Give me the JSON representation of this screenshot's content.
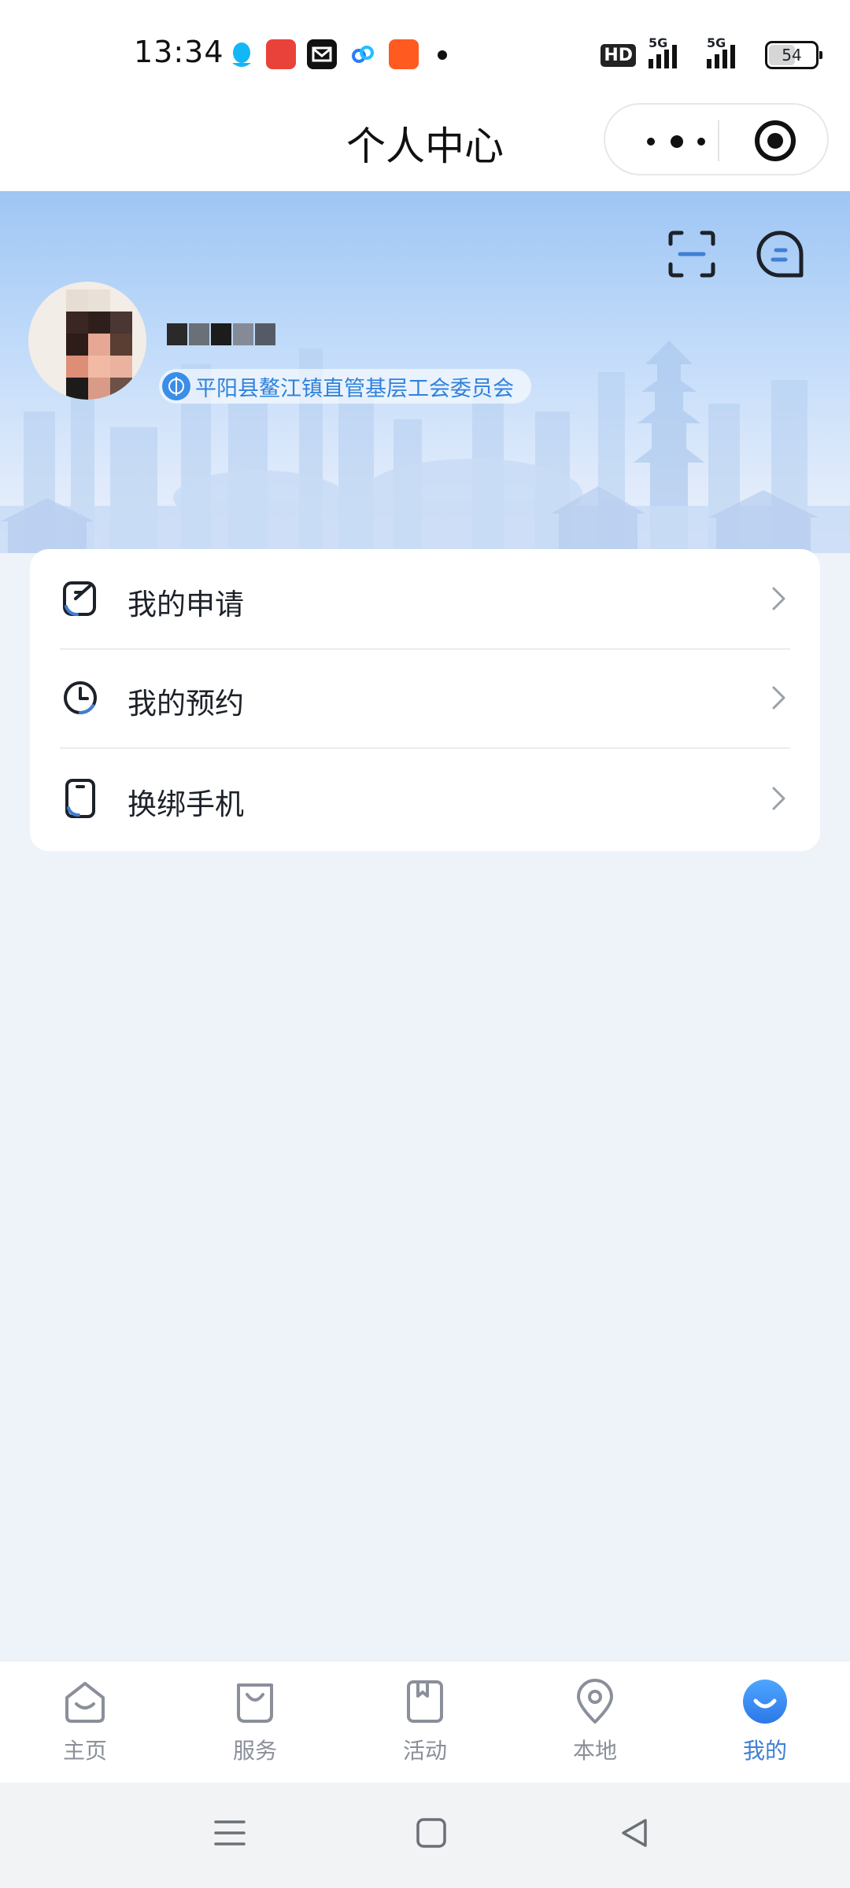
{
  "status_bar": {
    "time": "13:34",
    "hd_label": "HD",
    "network_1": "5G",
    "network_2": "5G",
    "battery": "54",
    "battery_level": 0.54,
    "notification_icons": [
      "qq-icon",
      "app-badge-icon",
      "mail-icon",
      "cloud-link-icon",
      "taobao-icon",
      "more-dot-icon"
    ]
  },
  "nav": {
    "title": "个人中心"
  },
  "profile": {
    "organization": "平阳县鳌江镇直管基层工会委员会"
  },
  "menu": [
    {
      "label": "我的申请",
      "icon": "edit-note-icon"
    },
    {
      "label": "我的预约",
      "icon": "clock-icon"
    },
    {
      "label": "换绑手机",
      "icon": "phone-icon"
    }
  ],
  "tabs": [
    {
      "label": "主页",
      "icon": "home-icon"
    },
    {
      "label": "服务",
      "icon": "shopping-bag-icon"
    },
    {
      "label": "活动",
      "icon": "bookmark-book-icon"
    },
    {
      "label": "本地",
      "icon": "location-pin-icon"
    },
    {
      "label": "我的",
      "icon": "profile-smile-icon",
      "active": true
    }
  ],
  "colors": {
    "accent": "#3f7fd4",
    "org_text": "#2f82dc",
    "page_bg": "#eef2f9",
    "tab_inactive": "#8a8f99"
  }
}
